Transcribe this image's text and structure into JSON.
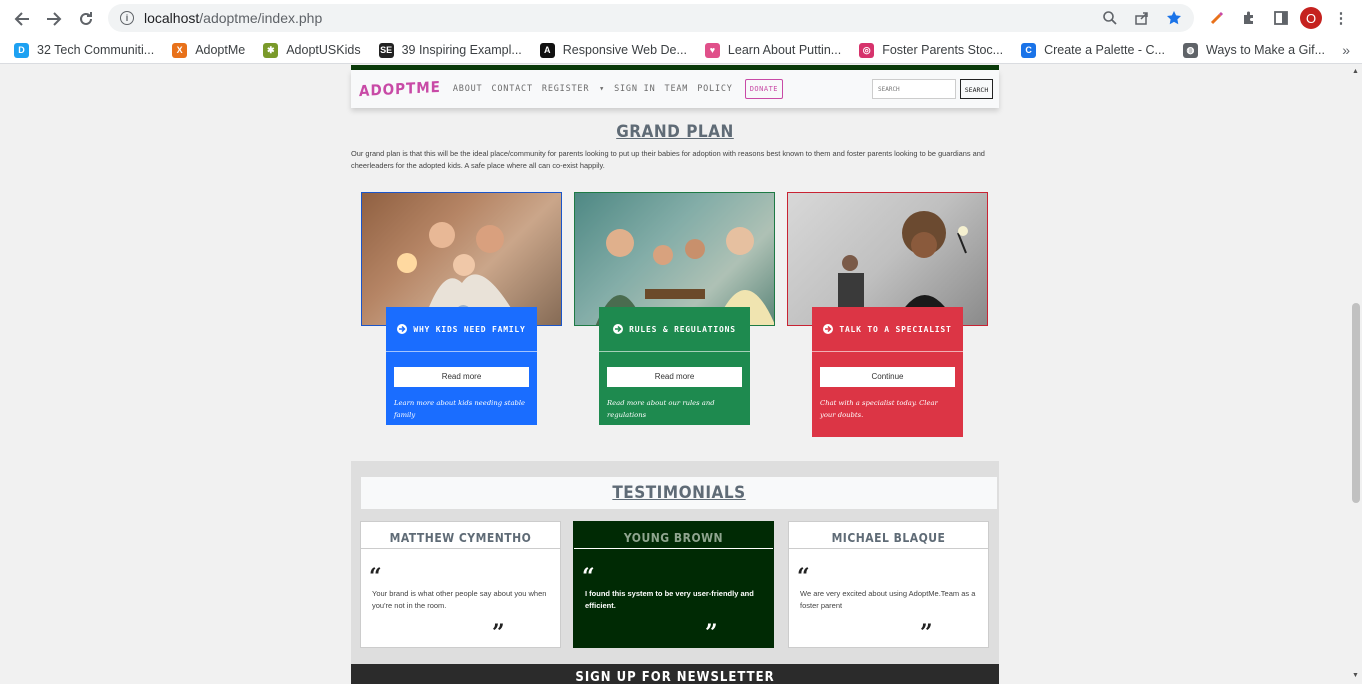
{
  "browser": {
    "url_host": "localhost",
    "url_path": "/adoptme/index.php",
    "profile_initial": "O",
    "bookmarks": [
      {
        "label": "32 Tech Communiti...",
        "color": "#1da1f2",
        "glyph": "D"
      },
      {
        "label": "AdoptMe",
        "color": "#e8711a",
        "glyph": "X"
      },
      {
        "label": "AdoptUSKids",
        "color": "#7a9a2a",
        "glyph": "✱"
      },
      {
        "label": "39 Inspiring Exampl...",
        "color": "#222222",
        "glyph": "SE"
      },
      {
        "label": "Responsive Web De...",
        "color": "#111111",
        "glyph": "A"
      },
      {
        "label": "Learn About Puttin...",
        "color": "#e0508a",
        "glyph": "♥"
      },
      {
        "label": "Foster Parents Stoc...",
        "color": "#d6336c",
        "glyph": "◎"
      },
      {
        "label": "Create a Palette - C...",
        "color": "#1a73e8",
        "glyph": "C"
      },
      {
        "label": "Ways to Make a Gif...",
        "color": "#5f6368",
        "glyph": "◍"
      }
    ]
  },
  "site_nav": {
    "logo": "ADOPTME",
    "links": [
      "ABOUT",
      "CONTACT",
      "REGISTER",
      "SIGN IN",
      "TEAM",
      "POLICY"
    ],
    "donate": "DONATE",
    "search_placeholder": "SEARCH",
    "search_button": "SEARCH"
  },
  "grand_plan": {
    "title": "GRAND PLAN",
    "text": "Our grand plan is that this will be the ideal place/community for parents looking to put up their babies for adoption with reasons best known to them and foster parents looking to be guardians and cheerleaders for the adopted kids. A safe place where all can co-exist happily.",
    "cards": [
      {
        "heading": "WHY KIDS NEED FAMILY",
        "button": "Read more",
        "note": "Learn more about kids needing stable family",
        "color": "#1a6dff",
        "border": "#1a55c9"
      },
      {
        "heading": "RULES & REGULATIONS",
        "button": "Read more",
        "note": "Read more about our rules and regulations",
        "color": "#1e8a4f",
        "border": "#1e7a45"
      },
      {
        "heading": "TALK TO A SPECIALIST",
        "button": "Continue",
        "note": "Chat with a specialist today. Clear your doubts.",
        "color": "#dc3545",
        "border": "#c82333"
      }
    ]
  },
  "testimonials": {
    "title": "TESTIMONIALS",
    "items": [
      {
        "name": "MATTHEW CYMENTHO",
        "quote": "Your brand is what other people say about you when you're not in the room."
      },
      {
        "name": "YOUNG BROWN",
        "quote": "I found this system to be very user-friendly and efficient."
      },
      {
        "name": "MICHAEL BLAQUE",
        "quote": "We are very excited about using AdoptMe.Team as a foster parent"
      }
    ]
  },
  "newsletter": {
    "title": "SIGN UP FOR NEWSLETTER"
  }
}
